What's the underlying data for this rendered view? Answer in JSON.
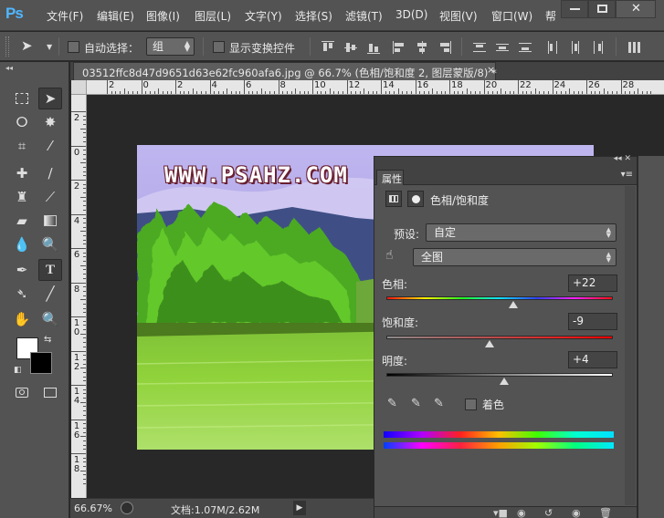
{
  "app": {
    "logo": "Ps"
  },
  "menu": [
    "文件(F)",
    "编辑(E)",
    "图像(I)",
    "图层(L)",
    "文字(Y)",
    "选择(S)",
    "滤镜(T)",
    "3D(D)",
    "视图(V)",
    "窗口(W)",
    "帮"
  ],
  "window_controls": {
    "minimize": "—",
    "maximize": "□",
    "close": "✕"
  },
  "options": {
    "auto_select_label": "自动选择：",
    "auto_select_checked": false,
    "group_value": "组",
    "show_transform_label": "显示变换控件",
    "show_transform_checked": false
  },
  "document": {
    "tab_title": "03512ffc8d47d9651d63e62fc960afa6.jpg @ 66.7% (色相/饱和度 2, 图层蒙版/8) *",
    "close": "×",
    "watermark": "WWW.PSAHZ.COM"
  },
  "ruler": {
    "h_labels": [
      "2",
      "0",
      "2",
      "4",
      "6",
      "8",
      "10",
      "12",
      "14",
      "16",
      "18",
      "20",
      "22",
      "24",
      "26",
      "28"
    ],
    "v_labels": [
      "2",
      "0",
      "2",
      "4",
      "6",
      "8",
      "1\n0",
      "1\n2",
      "1\n4",
      "1\n6",
      "1\n8"
    ]
  },
  "status": {
    "zoom": "66.67%",
    "doc_size": "文档:1.07M/2.62M"
  },
  "properties": {
    "tab_label": "属性",
    "adjustment_title": "色相/饱和度",
    "preset_label": "预设:",
    "preset_value": "自定",
    "channel_value": "全图",
    "hue_label": "色相:",
    "hue_value": "+22",
    "hue_level": 22,
    "saturation_label": "饱和度:",
    "saturation_value": "-9",
    "saturation_level": -9,
    "lightness_label": "明度:",
    "lightness_value": "+4",
    "lightness_level": 4,
    "colorize_label": "着色",
    "colorize_checked": false
  },
  "colors": {
    "panel_bg": "#535353",
    "canvas_bg": "#282828",
    "foreground": "#ffffff",
    "background": "#000000",
    "ps_blue": "#4fb6ff"
  },
  "icons": {
    "tools": [
      "marquee-icon",
      "move-icon",
      "lasso-icon",
      "magic-wand-icon",
      "crop-icon",
      "eyedropper-icon",
      "healing-brush-icon",
      "brush-icon",
      "clone-stamp-icon",
      "history-brush-icon",
      "eraser-icon",
      "gradient-icon",
      "blur-icon",
      "dodge-icon",
      "pen-icon",
      "type-icon",
      "path-selection-icon",
      "line-icon",
      "hand-icon",
      "zoom-icon",
      "quick-mask-icon",
      "screen-mode-icon"
    ]
  }
}
